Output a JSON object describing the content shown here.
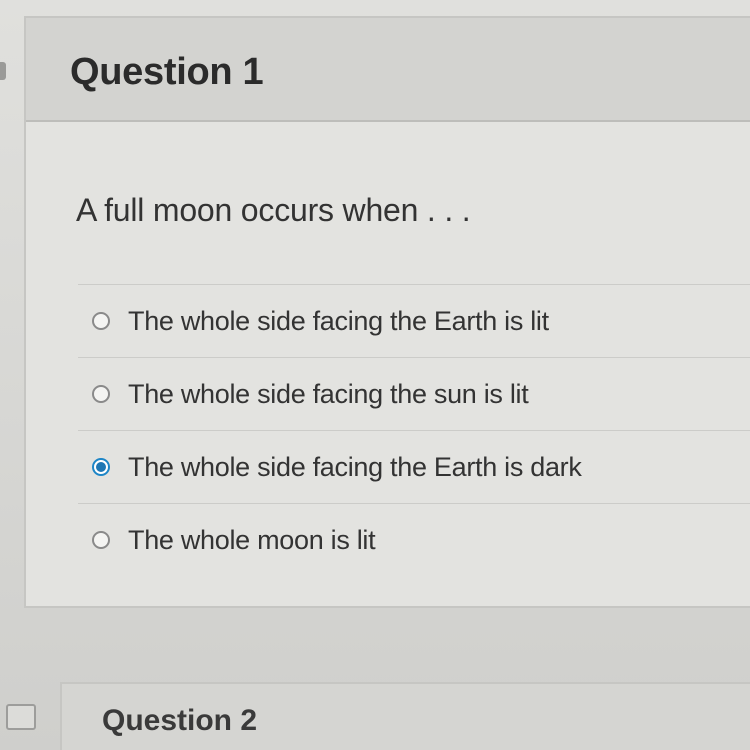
{
  "question_1": {
    "title": "Question 1",
    "prompt": "A full moon occurs when . . .",
    "options": [
      {
        "label": "The whole side facing the Earth is lit",
        "selected": false
      },
      {
        "label": "The whole side facing the sun is lit",
        "selected": false
      },
      {
        "label": "The whole side facing the Earth is dark",
        "selected": true
      },
      {
        "label": "The whole moon is lit",
        "selected": false
      }
    ]
  },
  "question_2": {
    "title": "Question 2"
  },
  "colors": {
    "selected_radio": "#1f77b4"
  }
}
